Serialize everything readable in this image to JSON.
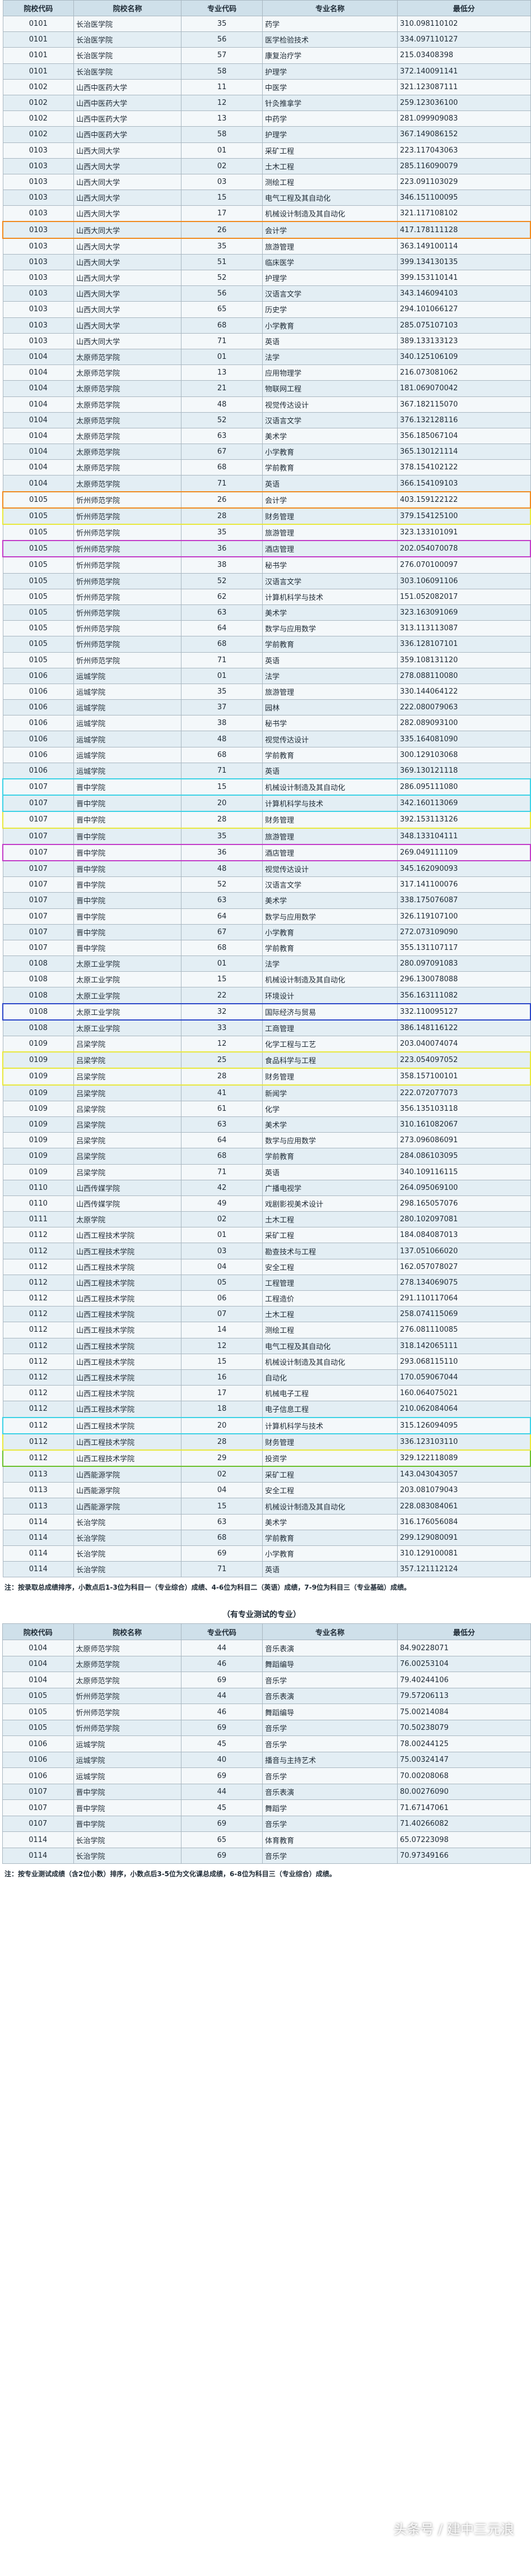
{
  "main_table": {
    "headers": [
      "院校代码",
      "院校名称",
      "专业代码",
      "专业名称",
      "最低分"
    ],
    "rows": [
      [
        "0101",
        "长治医学院",
        "35",
        "药学",
        "310.098110102",
        ""
      ],
      [
        "0101",
        "长治医学院",
        "56",
        "医学检验技术",
        "334.097110127",
        ""
      ],
      [
        "0101",
        "长治医学院",
        "57",
        "康复治疗学",
        "215.03408398",
        ""
      ],
      [
        "0101",
        "长治医学院",
        "58",
        "护理学",
        "372.140091141",
        ""
      ],
      [
        "0102",
        "山西中医药大学",
        "11",
        "中医学",
        "321.123087111",
        ""
      ],
      [
        "0102",
        "山西中医药大学",
        "12",
        "针灸推拿学",
        "259.123036100",
        ""
      ],
      [
        "0102",
        "山西中医药大学",
        "13",
        "中药学",
        "281.099909083",
        ""
      ],
      [
        "0102",
        "山西中医药大学",
        "58",
        "护理学",
        "367.149086152",
        ""
      ],
      [
        "0103",
        "山西大同大学",
        "01",
        "采矿工程",
        "223.117043063",
        ""
      ],
      [
        "0103",
        "山西大同大学",
        "02",
        "土木工程",
        "285.116090079",
        ""
      ],
      [
        "0103",
        "山西大同大学",
        "03",
        "测绘工程",
        "223.091103029",
        ""
      ],
      [
        "0103",
        "山西大同大学",
        "15",
        "电气工程及其自动化",
        "346.151100095",
        ""
      ],
      [
        "0103",
        "山西大同大学",
        "17",
        "机械设计制造及其自动化",
        "321.117108102",
        ""
      ],
      [
        "0103",
        "山西大同大学",
        "26",
        "会计学",
        "417.178111128",
        "#f08a1e"
      ],
      [
        "0103",
        "山西大同大学",
        "35",
        "旅游管理",
        "363.149100114",
        ""
      ],
      [
        "0103",
        "山西大同大学",
        "51",
        "临床医学",
        "399.134130135",
        ""
      ],
      [
        "0103",
        "山西大同大学",
        "52",
        "护理学",
        "399.153110141",
        ""
      ],
      [
        "0103",
        "山西大同大学",
        "56",
        "汉语言文学",
        "343.146094103",
        ""
      ],
      [
        "0103",
        "山西大同大学",
        "65",
        "历史学",
        "294.101066127",
        ""
      ],
      [
        "0103",
        "山西大同大学",
        "68",
        "小学教育",
        "285.075107103",
        ""
      ],
      [
        "0103",
        "山西大同大学",
        "71",
        "英语",
        "389.133133123",
        ""
      ],
      [
        "0104",
        "太原师范学院",
        "01",
        "法学",
        "340.125106109",
        ""
      ],
      [
        "0104",
        "太原师范学院",
        "13",
        "应用物理学",
        "216.073081062",
        ""
      ],
      [
        "0104",
        "太原师范学院",
        "21",
        "物联网工程",
        "181.069070042",
        ""
      ],
      [
        "0104",
        "太原师范学院",
        "48",
        "视觉传达设计",
        "367.182115070",
        ""
      ],
      [
        "0104",
        "太原师范学院",
        "52",
        "汉语言文学",
        "376.132128116",
        ""
      ],
      [
        "0104",
        "太原师范学院",
        "63",
        "美术学",
        "356.185067104",
        ""
      ],
      [
        "0104",
        "太原师范学院",
        "67",
        "小学教育",
        "365.130121114",
        ""
      ],
      [
        "0104",
        "太原师范学院",
        "68",
        "学前教育",
        "378.154102122",
        ""
      ],
      [
        "0104",
        "太原师范学院",
        "71",
        "英语",
        "366.154109103",
        ""
      ],
      [
        "0105",
        "忻州师范学院",
        "26",
        "会计学",
        "403.159122122",
        "#f08a1e"
      ],
      [
        "0105",
        "忻州师范学院",
        "28",
        "财务管理",
        "379.154125100",
        "#e8e83c"
      ],
      [
        "0105",
        "忻州师范学院",
        "35",
        "旅游管理",
        "323.133101091",
        ""
      ],
      [
        "0105",
        "忻州师范学院",
        "36",
        "酒店管理",
        "202.054070078",
        "#c23cc8"
      ],
      [
        "0105",
        "忻州师范学院",
        "38",
        "秘书学",
        "276.070100097",
        ""
      ],
      [
        "0105",
        "忻州师范学院",
        "52",
        "汉语言文学",
        "303.106091106",
        ""
      ],
      [
        "0105",
        "忻州师范学院",
        "62",
        "计算机科学与技术",
        "151.052082017",
        ""
      ],
      [
        "0105",
        "忻州师范学院",
        "63",
        "美术学",
        "323.163091069",
        ""
      ],
      [
        "0105",
        "忻州师范学院",
        "64",
        "数学与应用数学",
        "313.113113087",
        ""
      ],
      [
        "0105",
        "忻州师范学院",
        "68",
        "学前教育",
        "336.128107101",
        ""
      ],
      [
        "0105",
        "忻州师范学院",
        "71",
        "英语",
        "359.108131120",
        ""
      ],
      [
        "0106",
        "运城学院",
        "01",
        "法学",
        "278.088110080",
        ""
      ],
      [
        "0106",
        "运城学院",
        "35",
        "旅游管理",
        "330.144064122",
        ""
      ],
      [
        "0106",
        "运城学院",
        "37",
        "园林",
        "222.080079063",
        ""
      ],
      [
        "0106",
        "运城学院",
        "38",
        "秘书学",
        "282.089093100",
        ""
      ],
      [
        "0106",
        "运城学院",
        "48",
        "视觉传达设计",
        "335.164081090",
        ""
      ],
      [
        "0106",
        "运城学院",
        "68",
        "学前教育",
        "300.129103068",
        ""
      ],
      [
        "0106",
        "运城学院",
        "71",
        "英语",
        "369.130121118",
        ""
      ],
      [
        "0107",
        "晋中学院",
        "15",
        "机械设计制造及其自动化",
        "286.095111080",
        "#3cd2e6"
      ],
      [
        "0107",
        "晋中学院",
        "20",
        "计算机科学与技术",
        "342.160113069",
        "#3cd2e6"
      ],
      [
        "0107",
        "晋中学院",
        "28",
        "财务管理",
        "392.153113126",
        "#e8e83c"
      ],
      [
        "0107",
        "晋中学院",
        "35",
        "旅游管理",
        "348.133104111",
        ""
      ],
      [
        "0107",
        "晋中学院",
        "36",
        "酒店管理",
        "269.049111109",
        "#c23cc8"
      ],
      [
        "0107",
        "晋中学院",
        "48",
        "视觉传达设计",
        "345.162090093",
        ""
      ],
      [
        "0107",
        "晋中学院",
        "52",
        "汉语言文学",
        "317.141100076",
        ""
      ],
      [
        "0107",
        "晋中学院",
        "63",
        "美术学",
        "338.175076087",
        ""
      ],
      [
        "0107",
        "晋中学院",
        "64",
        "数学与应用数学",
        "326.119107100",
        ""
      ],
      [
        "0107",
        "晋中学院",
        "67",
        "小学教育",
        "272.073109090",
        ""
      ],
      [
        "0107",
        "晋中学院",
        "68",
        "学前教育",
        "355.131107117",
        ""
      ],
      [
        "0108",
        "太原工业学院",
        "01",
        "法学",
        "280.097091083",
        ""
      ],
      [
        "0108",
        "太原工业学院",
        "15",
        "机械设计制造及其自动化",
        "296.130078088",
        ""
      ],
      [
        "0108",
        "太原工业学院",
        "22",
        "环境设计",
        "356.163111082",
        ""
      ],
      [
        "0108",
        "太原工业学院",
        "32",
        "国际经济与贸易",
        "332.110095127",
        "#2b46c8"
      ],
      [
        "0108",
        "太原工业学院",
        "33",
        "工商管理",
        "386.148116122",
        ""
      ],
      [
        "0109",
        "吕梁学院",
        "12",
        "化学工程与工艺",
        "203.040074074",
        ""
      ],
      [
        "0109",
        "吕梁学院",
        "25",
        "食品科学与工程",
        "223.054097052",
        "#e8e83c"
      ],
      [
        "0109",
        "吕梁学院",
        "28",
        "财务管理",
        "358.157100101",
        "#e8e83c"
      ],
      [
        "0109",
        "吕梁学院",
        "41",
        "新闻学",
        "222.072077073",
        ""
      ],
      [
        "0109",
        "吕梁学院",
        "61",
        "化学",
        "356.135103118",
        ""
      ],
      [
        "0109",
        "吕梁学院",
        "63",
        "美术学",
        "310.161082067",
        ""
      ],
      [
        "0109",
        "吕梁学院",
        "64",
        "数学与应用数学",
        "273.096086091",
        ""
      ],
      [
        "0109",
        "吕梁学院",
        "68",
        "学前教育",
        "284.086103095",
        ""
      ],
      [
        "0109",
        "吕梁学院",
        "71",
        "英语",
        "340.109116115",
        ""
      ],
      [
        "0110",
        "山西传媒学院",
        "42",
        "广播电视学",
        "264.095069100",
        ""
      ],
      [
        "0110",
        "山西传媒学院",
        "49",
        "戏剧影视美术设计",
        "298.165057076",
        ""
      ],
      [
        "0111",
        "太原学院",
        "02",
        "土木工程",
        "280.102097081",
        ""
      ],
      [
        "0112",
        "山西工程技术学院",
        "01",
        "采矿工程",
        "184.084087013",
        ""
      ],
      [
        "0112",
        "山西工程技术学院",
        "03",
        "勘查技术与工程",
        "137.051066020",
        ""
      ],
      [
        "0112",
        "山西工程技术学院",
        "04",
        "安全工程",
        "162.057078027",
        ""
      ],
      [
        "0112",
        "山西工程技术学院",
        "05",
        "工程管理",
        "278.134069075",
        ""
      ],
      [
        "0112",
        "山西工程技术学院",
        "06",
        "工程造价",
        "291.110117064",
        ""
      ],
      [
        "0112",
        "山西工程技术学院",
        "07",
        "土木工程",
        "258.074115069",
        ""
      ],
      [
        "0112",
        "山西工程技术学院",
        "14",
        "测绘工程",
        "276.081110085",
        ""
      ],
      [
        "0112",
        "山西工程技术学院",
        "12",
        "电气工程及其自动化",
        "318.142065111",
        ""
      ],
      [
        "0112",
        "山西工程技术学院",
        "15",
        "机械设计制造及其自动化",
        "293.068115110",
        ""
      ],
      [
        "0112",
        "山西工程技术学院",
        "16",
        "自动化",
        "170.059067044",
        ""
      ],
      [
        "0112",
        "山西工程技术学院",
        "17",
        "机械电子工程",
        "160.064075021",
        ""
      ],
      [
        "0112",
        "山西工程技术学院",
        "18",
        "电子信息工程",
        "210.062084064",
        ""
      ],
      [
        "0112",
        "山西工程技术学院",
        "20",
        "计算机科学与技术",
        "315.126094095",
        "#3cd2e6"
      ],
      [
        "0112",
        "山西工程技术学院",
        "28",
        "财务管理",
        "336.123103110",
        "#e8e83c"
      ],
      [
        "0112",
        "山西工程技术学院",
        "29",
        "投资学",
        "329.122118089",
        "#6ac02a"
      ],
      [
        "0113",
        "山西能源学院",
        "02",
        "采矿工程",
        "143.043043057",
        ""
      ],
      [
        "0113",
        "山西能源学院",
        "04",
        "安全工程",
        "203.081079043",
        ""
      ],
      [
        "0113",
        "山西能源学院",
        "15",
        "机械设计制造及其自动化",
        "228.083084061",
        ""
      ],
      [
        "0114",
        "长治学院",
        "63",
        "美术学",
        "316.176056084",
        ""
      ],
      [
        "0114",
        "长治学院",
        "68",
        "学前教育",
        "299.129080091",
        ""
      ],
      [
        "0114",
        "长治学院",
        "69",
        "小学教育",
        "310.129100081",
        ""
      ],
      [
        "0114",
        "长治学院",
        "71",
        "英语",
        "357.121112124",
        ""
      ]
    ]
  },
  "note1": "注：按录取总成绩排序，小数点后1-3位为科目一（专业综合）成绩、4-6位为科目二（英语）成绩，7-9位为科目三（专业基础）成绩。",
  "table2": {
    "title": "（有专业测试的专业）",
    "headers": [
      "院校代码",
      "院校名称",
      "专业代码",
      "专业名称",
      "最低分"
    ],
    "rows": [
      [
        "0104",
        "太原师范学院",
        "44",
        "音乐表演",
        "84.90228071"
      ],
      [
        "0104",
        "太原师范学院",
        "46",
        "舞蹈编导",
        "76.00253104"
      ],
      [
        "0104",
        "太原师范学院",
        "69",
        "音乐学",
        "79.40244106"
      ],
      [
        "0105",
        "忻州师范学院",
        "44",
        "音乐表演",
        "79.57206113"
      ],
      [
        "0105",
        "忻州师范学院",
        "46",
        "舞蹈编导",
        "75.00214084"
      ],
      [
        "0105",
        "忻州师范学院",
        "69",
        "音乐学",
        "70.50238079"
      ],
      [
        "0106",
        "运城学院",
        "45",
        "音乐学",
        "78.00244125"
      ],
      [
        "0106",
        "运城学院",
        "40",
        "播音与主持艺术",
        "75.00324147"
      ],
      [
        "0106",
        "运城学院",
        "69",
        "音乐学",
        "70.00208068"
      ],
      [
        "0107",
        "晋中学院",
        "44",
        "音乐表演",
        "80.00276090"
      ],
      [
        "0107",
        "晋中学院",
        "45",
        "舞蹈学",
        "71.67147061"
      ],
      [
        "0107",
        "晋中学院",
        "69",
        "音乐学",
        "71.40266082"
      ],
      [
        "0114",
        "长治学院",
        "65",
        "体育教育",
        "65.07223098"
      ],
      [
        "0114",
        "长治学院",
        "69",
        "音乐学",
        "70.97349166"
      ]
    ]
  },
  "note2": "注：按专业测试成绩（含2位小数）排序，小数点后3-5位为文化课总成绩，6-8位为科目三（专业综合）成绩。",
  "watermark": "头条号 / 建中三元浪"
}
